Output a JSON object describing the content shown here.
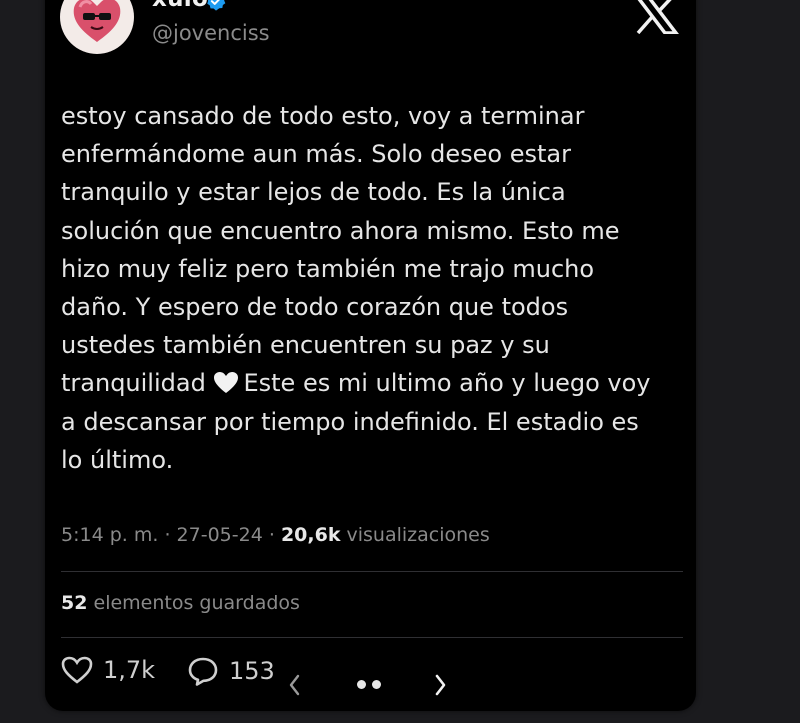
{
  "tweet": {
    "author": {
      "name": "xulo",
      "handle": "@jovenciss",
      "verified": true
    },
    "body_lines": [
      "estoy cansado de todo esto, voy a terminar",
      "enfermándome aun más. Solo deseo estar",
      "tranquilo y estar lejos de todo. Es la única",
      "solución que encuentro ahora mismo. Esto me",
      "hizo muy feliz pero también me trajo mucho",
      "daño. Y espero de todo corazón que todos",
      "ustedes también encuentren su paz y su"
    ],
    "heart_line_before": "tranquilidad",
    "heart_line_after": "Este es mi ultimo año y luego voy",
    "body_lines_end": [
      "a descansar por tiempo indefinido. El estadio es",
      "lo último."
    ],
    "meta": {
      "time": "5:14 p. m.",
      "sep1": "·",
      "date": "27-05-24",
      "sep2": "·",
      "views_count": "20,6k",
      "views_label": "visualizaciones"
    },
    "bookmarks": {
      "count": "52",
      "label": "elementos guardados"
    },
    "actions": {
      "likes": "1,7k",
      "replies": "153"
    }
  },
  "colors": {
    "background": "#1b1b1e",
    "card": "#000000",
    "text": "#e6e6e6",
    "muted": "#8a8a8a",
    "verified": "#1d9bf0",
    "heart_emoji": "#f2f2f2"
  },
  "icons": [
    "verified-badge-icon",
    "x-logo-icon",
    "white-heart-emoji",
    "like-heart-icon",
    "reply-bubble-icon",
    "chevron-left-icon",
    "chevron-right-icon"
  ]
}
